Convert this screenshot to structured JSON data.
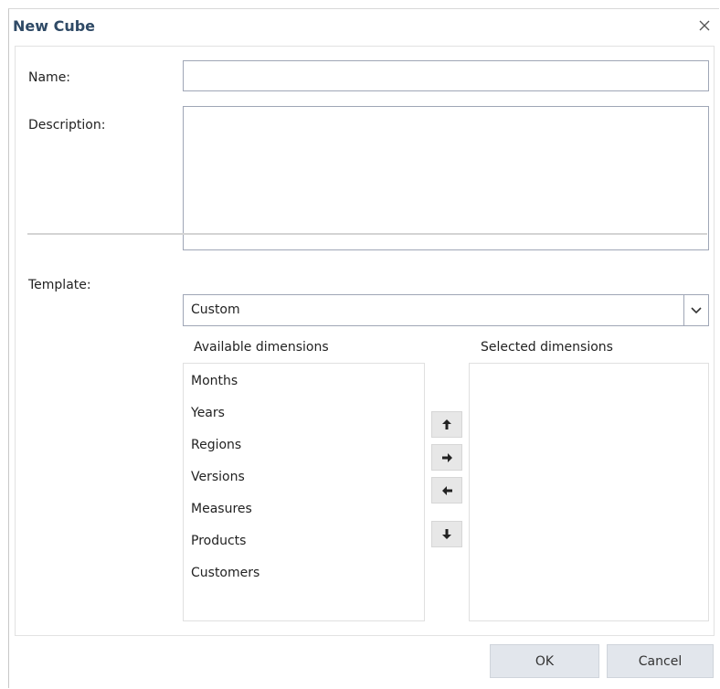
{
  "dialog": {
    "title": "New Cube",
    "close_icon": "close-icon"
  },
  "form": {
    "name_label": "Name:",
    "name_value": "",
    "description_label": "Description:",
    "description_value": "",
    "template_label": "Template:",
    "template_value": "Custom",
    "template_arrow_icon": "chevron-down-icon"
  },
  "available": {
    "header": "Available dimensions",
    "items": [
      "Months",
      "Years",
      "Regions",
      "Versions",
      "Measures",
      "Products",
      "Customers"
    ]
  },
  "selected": {
    "header": "Selected dimensions",
    "items": []
  },
  "move_buttons": {
    "icons": [
      "arrow-up-icon",
      "arrow-right-icon",
      "arrow-left-icon",
      "arrow-down-icon"
    ]
  },
  "footer": {
    "ok_label": "OK",
    "cancel_label": "Cancel"
  }
}
